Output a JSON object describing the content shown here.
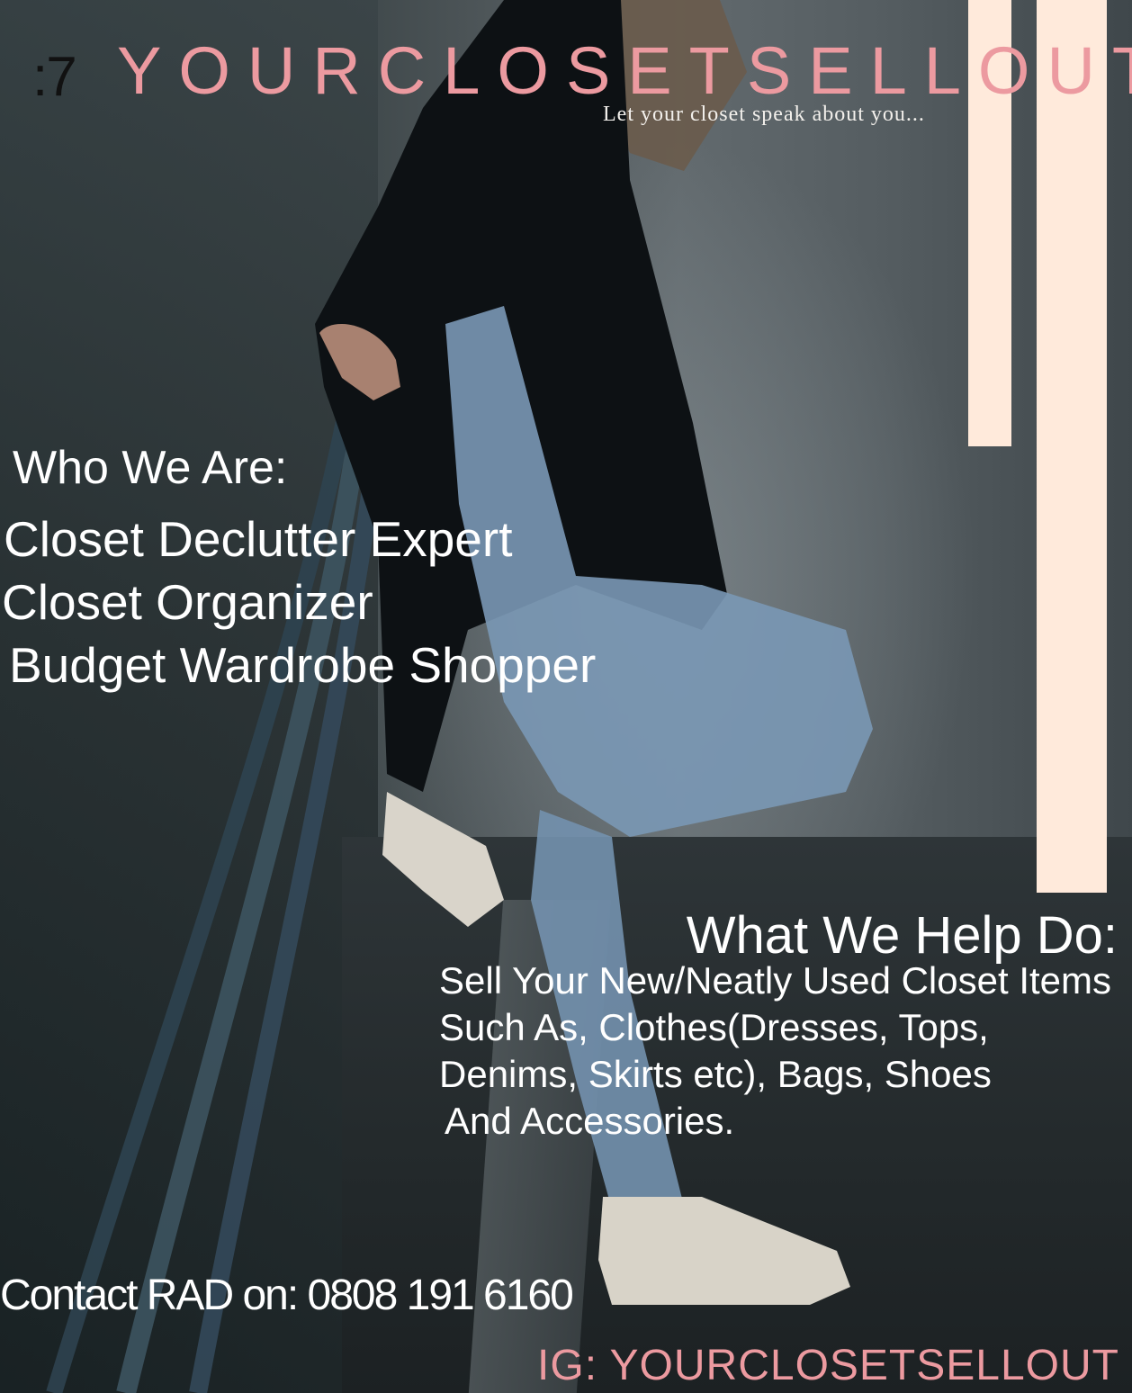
{
  "logo_mark": ":7",
  "brand": {
    "title": "YOURCLOSETSELLOUT",
    "tagline": "Let your closet speak about you...",
    "accent_color": "#ec9aa0",
    "stripe_color": "#ffeadb"
  },
  "who": {
    "heading": "Who We Are:",
    "items": [
      "Closet Declutter Expert",
      "Closet Organizer",
      "Budget Wardrobe Shopper"
    ]
  },
  "help": {
    "heading": "What We Help Do:",
    "lines": [
      "Sell Your New/Neatly Used Closet Items",
      "Such As, Clothes(Dresses, Tops,",
      "Denims, Skirts etc), Bags, Shoes",
      "And Accessories."
    ]
  },
  "contact": "Contact RAD on: 0808 191 6160",
  "instagram": "IG: YOURCLOSETSELLOUT"
}
